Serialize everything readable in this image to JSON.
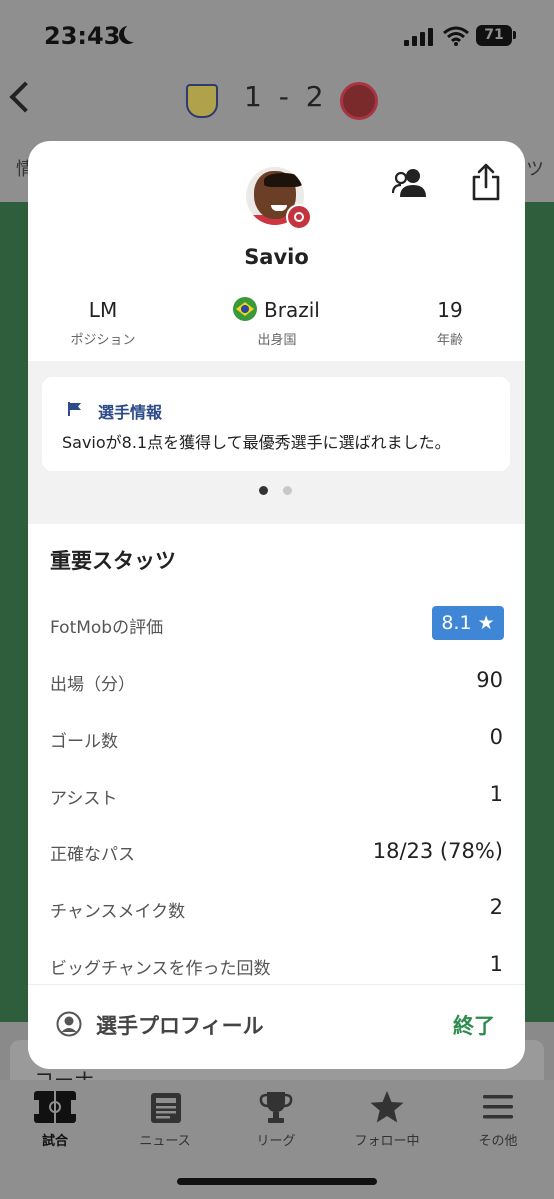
{
  "status_bar": {
    "time": "23:43",
    "battery": "71"
  },
  "match_header": {
    "score": "1 - 2",
    "tab_left_partial": "情",
    "tab_right_partial": "ツ"
  },
  "background": {
    "corner_partial": "コーナ"
  },
  "player": {
    "name": "Savio",
    "position": {
      "value": "LM",
      "label": "ポジション"
    },
    "country": {
      "value": "Brazil",
      "label": "出身国"
    },
    "age": {
      "value": "19",
      "label": "年齢"
    }
  },
  "insight_card": {
    "title": "選手情報",
    "text": "Savioが8.1点を獲得して最優秀選手に選ばれました。",
    "page_dots": 2,
    "active_dot": 1
  },
  "stats": {
    "title": "重要スタッツ",
    "rating_label": "FotMobの評価",
    "rating_value": "8.1 ★",
    "rows": [
      {
        "label": "出場（分）",
        "value": "90"
      },
      {
        "label": "ゴール数",
        "value": "0"
      },
      {
        "label": "アシスト",
        "value": "1"
      },
      {
        "label": "正確なパス",
        "value": "18/23 (78%)"
      },
      {
        "label": "チャンスメイク数",
        "value": "2"
      },
      {
        "label": "ビッグチャンスを作った回数",
        "value": "1"
      }
    ]
  },
  "footer": {
    "profile_label": "選手プロフィール",
    "close_label": "終了"
  },
  "bottom_nav": {
    "items": [
      {
        "label": "試合",
        "icon": "pitch-icon"
      },
      {
        "label": "ニュース",
        "icon": "news-icon"
      },
      {
        "label": "リーグ",
        "icon": "trophy-icon"
      },
      {
        "label": "フォロー中",
        "icon": "star-icon"
      },
      {
        "label": "その他",
        "icon": "menu-icon"
      }
    ]
  },
  "colors": {
    "accent_green": "#2e8b4d",
    "rating_blue": "#3f87d6",
    "card_title_blue": "#2d4a8a"
  }
}
